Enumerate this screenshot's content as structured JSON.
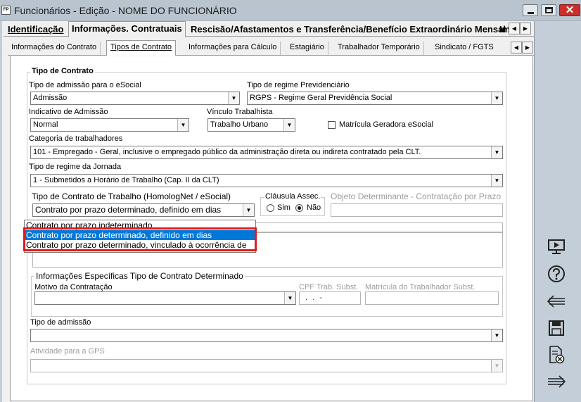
{
  "window": {
    "icon_text": "FP",
    "title": "Funcionários - Edição - NOME DO FUNCIONÁRIO",
    "close_glyph": "✕"
  },
  "tabs_main": [
    {
      "label": "Identificação"
    },
    {
      "label": "Informações. Contratuais"
    },
    {
      "label": "Rescisão/Afastamentos e Transferência/Benefício Extraordinário Mensal"
    },
    {
      "label": "Im"
    }
  ],
  "tabs_sub": [
    {
      "label": "Informações do Contrato"
    },
    {
      "label": "Tipos de Contrato"
    },
    {
      "label": "Informações para Cálculo"
    },
    {
      "label": "Estagiário"
    },
    {
      "label": "Trabalhador Temporário"
    },
    {
      "label": "Sindicato / FGTS"
    }
  ],
  "nav_arrows": {
    "left": "◀",
    "right": "▶"
  },
  "group_tipo_contrato": {
    "title": "Tipo de Contrato"
  },
  "fields": {
    "tipo_admissao_esocial": {
      "label": "Tipo de admissão para o eSocial",
      "value": "Admissão"
    },
    "tipo_regime_prev": {
      "label": "Tipo de regime Previdenciário",
      "value": "RGPS - Regime Geral Previdência Social"
    },
    "indicativo_admissao": {
      "label": "Indicativo de Admissão",
      "value": "Normal"
    },
    "vinculo_trabalhista": {
      "label": "Vínculo Trabalhista",
      "value": "Trabalho Urbano"
    },
    "matricula_geradora": {
      "label": "Matrícula Geradora eSocial",
      "checked": false
    },
    "categoria_trabalhadores": {
      "label": "Categoria de trabalhadores",
      "value": "101 - Empregado - Geral, inclusive o empregado público da administração direta ou indireta contratado pela CLT."
    },
    "tipo_regime_jornada": {
      "label": "Tipo de regime da Jornada",
      "value": "1 - Submetidos a Horário de Trabalho (Cap. II da CLT)"
    },
    "tipo_contrato_trabalho": {
      "label": "Tipo de Contrato de Trabalho (HomologNet / eSocial)",
      "value": "Contrato por prazo determinado, definido em dias"
    },
    "clausula_assec": {
      "label": "Cláusula Assec.",
      "options": [
        "Sim",
        "Não"
      ],
      "selected": "Não"
    },
    "objeto_determinante": {
      "label": "Objeto Determinante - Contratação por Prazo"
    },
    "tipo_admissao": {
      "label": "Tipo de admissão",
      "value": ""
    },
    "atividade_gps": {
      "label": "Atividade para a GPS",
      "value": ""
    }
  },
  "dropdown_options": [
    {
      "label": "Contrato por prazo indeterminado",
      "selected": false
    },
    {
      "label": "Contrato por prazo determinado, definido em dias",
      "selected": true
    },
    {
      "label": "Contrato por prazo determinado, vinculado à ocorrência de",
      "selected": false
    }
  ],
  "group_determinado": {
    "title": "Informações Específicas Tipo de Contrato Determinado",
    "motivo_label": "Motivo da Contratação",
    "cpf_label": "CPF Trab. Subst.",
    "cpf_mask": ". . -",
    "matricula_label": "Matrícula do Trabalhador Subst."
  },
  "sidebar_buttons": [
    {
      "name": "presentation-icon"
    },
    {
      "name": "help-icon"
    },
    {
      "name": "back-arrow-icon"
    },
    {
      "name": "save-icon"
    },
    {
      "name": "cancel-document-icon"
    },
    {
      "name": "forward-arrow-icon"
    }
  ],
  "colors": {
    "highlight": "#e31a1a",
    "selection": "#0078d7"
  },
  "dd_arrow": "▼"
}
